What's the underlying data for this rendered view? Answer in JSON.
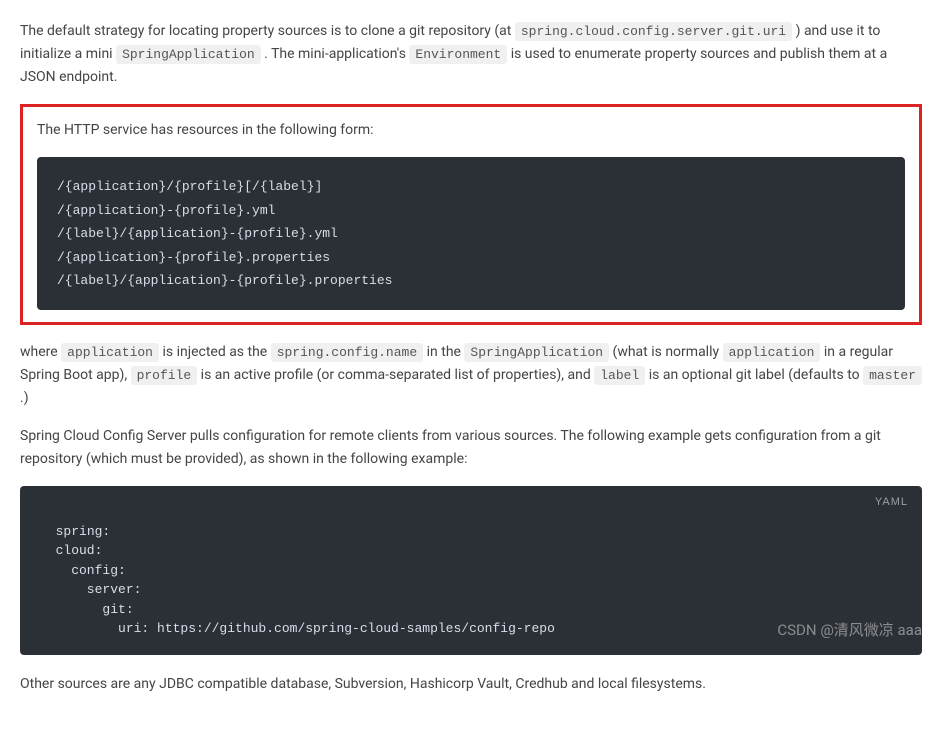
{
  "para1": {
    "text1": "The default strategy for locating property sources is to clone a git repository (at ",
    "code1": "spring.cloud.config.server.git.uri",
    "text2": " ) and use it to initialize a mini ",
    "code2": "SpringApplication",
    "text3": " . The mini-application's ",
    "code3": "Environment",
    "text4": " is used to enumerate property sources and publish them at a JSON endpoint."
  },
  "highlight": {
    "intro": "The HTTP service has resources in the following form:",
    "lines": [
      "/{application}/{profile}[/{label}]",
      "/{application}-{profile}.yml",
      "/{label}/{application}-{profile}.yml",
      "/{application}-{profile}.properties",
      "/{label}/{application}-{profile}.properties"
    ]
  },
  "para2": {
    "text1": "where ",
    "code1": "application",
    "text2": " is injected as the ",
    "code2": "spring.config.name",
    "text3": " in the ",
    "code3": "SpringApplication",
    "text4": " (what is normally ",
    "code4": "application",
    "text5": " in a regular Spring Boot app), ",
    "code5": "profile",
    "text6": " is an active profile (or comma-separated list of properties), and ",
    "code6": "label",
    "text7": " is an optional git label (defaults to ",
    "code7": "master",
    "text8": " .)"
  },
  "para3": "Spring Cloud Config Server pulls configuration for remote clients from various sources. The following example gets configuration from a git repository (which must be provided), as shown in the following example:",
  "yaml": {
    "badge": "YAML",
    "content": "spring:\n  cloud:\n    config:\n      server:\n        git:\n          uri: https://github.com/spring-cloud-samples/config-repo"
  },
  "para4": "Other sources are any JDBC compatible database, Subversion, Hashicorp Vault, Credhub and local filesystems.",
  "watermark": "CSDN @清风微凉 aaa"
}
